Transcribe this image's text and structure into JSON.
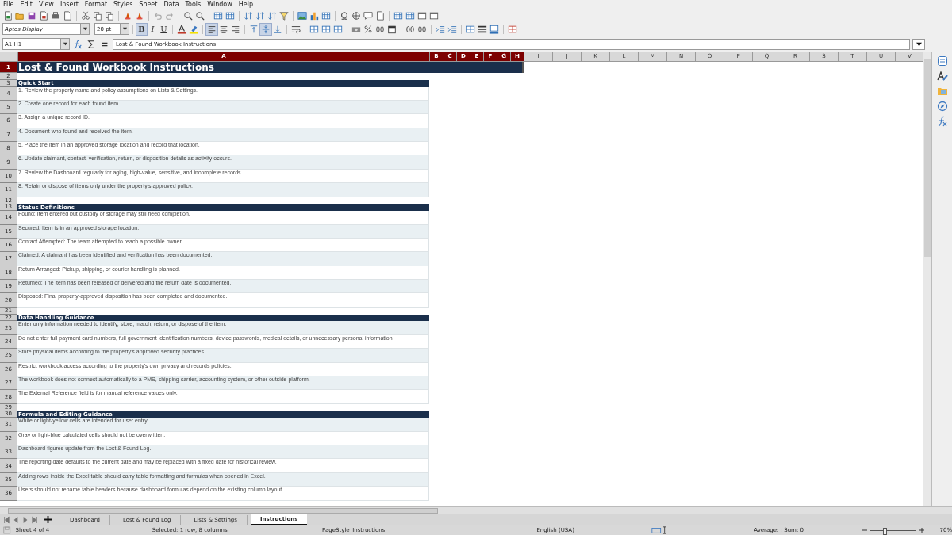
{
  "menu": [
    "File",
    "Edit",
    "View",
    "Insert",
    "Format",
    "Styles",
    "Sheet",
    "Data",
    "Tools",
    "Window",
    "Help"
  ],
  "toolbar": {
    "font_name": "Aptos Display",
    "font_size": "20 pt",
    "toggles": [
      {
        "kind": "bold",
        "label": "B",
        "on": true
      },
      {
        "kind": "italic",
        "label": "I",
        "on": false
      },
      {
        "kind": "underline",
        "label": "U",
        "on": false
      }
    ],
    "alignment": [
      {
        "kind": "left",
        "on": true
      },
      {
        "kind": "center",
        "on": false
      },
      {
        "kind": "right",
        "on": false
      },
      {
        "kind": "top",
        "on": false
      },
      {
        "kind": "middle",
        "on": true
      },
      {
        "kind": "bottom",
        "on": false
      }
    ]
  },
  "formula_bar": {
    "name_box": "A1:H1",
    "content": "Lost & Found Workbook Instructions"
  },
  "columns": [
    {
      "label": "A",
      "selected": true
    },
    {
      "label": "B",
      "selected": true
    },
    {
      "label": "C",
      "selected": true
    },
    {
      "label": "D",
      "selected": true
    },
    {
      "label": "E",
      "selected": true
    },
    {
      "label": "F",
      "selected": true
    },
    {
      "label": "G",
      "selected": true
    },
    {
      "label": "H",
      "selected": true
    },
    {
      "label": "I",
      "selected": false
    },
    {
      "label": "J",
      "selected": false
    },
    {
      "label": "K",
      "selected": false
    },
    {
      "label": "L",
      "selected": false
    },
    {
      "label": "M",
      "selected": false
    },
    {
      "label": "N",
      "selected": false
    },
    {
      "label": "O",
      "selected": false
    },
    {
      "label": "P",
      "selected": false
    },
    {
      "label": "Q",
      "selected": false
    },
    {
      "label": "R",
      "selected": false
    },
    {
      "label": "S",
      "selected": false
    },
    {
      "label": "T",
      "selected": false
    },
    {
      "label": "U",
      "selected": false
    },
    {
      "label": "V",
      "selected": false
    }
  ],
  "rows": [
    {
      "number": "1",
      "kind": "title",
      "text": "Lost & Found Workbook Instructions",
      "selected": true
    },
    {
      "number": "2",
      "kind": "blank",
      "selected": false
    },
    {
      "number": "3",
      "kind": "section",
      "text": "Quick Start",
      "selected": false
    },
    {
      "number": "4",
      "kind": "text",
      "text": "1. Review the property name and policy assumptions on Lists & Settings.",
      "selected": false,
      "shaded": false
    },
    {
      "number": "5",
      "kind": "text",
      "text": "2. Create one record for each found item.",
      "selected": false,
      "shaded": true
    },
    {
      "number": "6",
      "kind": "text",
      "text": "3. Assign a unique record ID.",
      "selected": false,
      "shaded": false
    },
    {
      "number": "7",
      "kind": "text",
      "text": "4. Document who found and received the item.",
      "selected": false,
      "shaded": true
    },
    {
      "number": "8",
      "kind": "text",
      "text": "5. Place the item in an approved storage location and record that location.",
      "selected": false,
      "shaded": false
    },
    {
      "number": "9",
      "kind": "text",
      "text": "6. Update claimant, contact, verification, return, or disposition details as activity occurs.",
      "selected": false,
      "shaded": true
    },
    {
      "number": "10",
      "kind": "text",
      "text": "7. Review the Dashboard regularly for aging, high-value, sensitive, and incomplete records.",
      "selected": false,
      "shaded": false
    },
    {
      "number": "11",
      "kind": "text",
      "text": "8. Retain or dispose of items only under the property's approved policy.",
      "selected": false,
      "shaded": true
    },
    {
      "number": "12",
      "kind": "blank",
      "selected": false
    },
    {
      "number": "13",
      "kind": "section",
      "text": "Status Definitions",
      "selected": false
    },
    {
      "number": "14",
      "kind": "text",
      "text": "Found: Item entered but custody or storage may still need completion.",
      "selected": false,
      "shaded": false
    },
    {
      "number": "15",
      "kind": "text",
      "text": "Secured: Item is in an approved storage location.",
      "selected": false,
      "shaded": true
    },
    {
      "number": "16",
      "kind": "text",
      "text": "Contact Attempted: The team attempted to reach a possible owner.",
      "selected": false,
      "shaded": false
    },
    {
      "number": "17",
      "kind": "text",
      "text": "Claimed: A claimant has been identified and verification has been documented.",
      "selected": false,
      "shaded": true
    },
    {
      "number": "18",
      "kind": "text",
      "text": "Return Arranged: Pickup, shipping, or courier handling is planned.",
      "selected": false,
      "shaded": false
    },
    {
      "number": "19",
      "kind": "text",
      "text": "Returned: The item has been released or delivered and the return date is documented.",
      "selected": false,
      "shaded": true
    },
    {
      "number": "20",
      "kind": "text",
      "text": "Disposed: Final property-approved disposition has been completed and documented.",
      "selected": false,
      "shaded": false
    },
    {
      "number": "21",
      "kind": "blank",
      "selected": false
    },
    {
      "number": "22",
      "kind": "section",
      "text": "Data Handling Guidance",
      "selected": false
    },
    {
      "number": "23",
      "kind": "text",
      "text": "Enter only information needed to identify, store, match, return, or dispose of the item.",
      "selected": false,
      "shaded": true
    },
    {
      "number": "24",
      "kind": "text",
      "text": "Do not enter full payment card numbers, full government identification numbers, device passwords, medical details, or unnecessary personal information.",
      "selected": false,
      "shaded": false
    },
    {
      "number": "25",
      "kind": "text",
      "text": "Store physical items according to the property's approved security practices.",
      "selected": false,
      "shaded": true
    },
    {
      "number": "26",
      "kind": "text",
      "text": "Restrict workbook access according to the property's own privacy and records policies.",
      "selected": false,
      "shaded": false
    },
    {
      "number": "27",
      "kind": "text",
      "text": "The workbook does not connect automatically to a PMS, shipping carrier, accounting system, or other outside platform.",
      "selected": false,
      "shaded": true
    },
    {
      "number": "28",
      "kind": "text",
      "text": "The External Reference field is for manual reference values only.",
      "selected": false,
      "shaded": false
    },
    {
      "number": "29",
      "kind": "blank",
      "selected": false
    },
    {
      "number": "30",
      "kind": "section",
      "text": "Formula and Editing Guidance",
      "selected": false
    },
    {
      "number": "31",
      "kind": "text",
      "text": "White or light-yellow cells are intended for user entry.",
      "selected": false,
      "shaded": true
    },
    {
      "number": "32",
      "kind": "text",
      "text": "Gray or light-blue calculated cells should not be overwritten.",
      "selected": false,
      "shaded": false
    },
    {
      "number": "33",
      "kind": "text",
      "text": "Dashboard figures update from the Lost & Found Log.",
      "selected": false,
      "shaded": true
    },
    {
      "number": "34",
      "kind": "text",
      "text": "The reporting date defaults to the current date and may be replaced with a fixed date for historical review.",
      "selected": false,
      "shaded": false
    },
    {
      "number": "35",
      "kind": "text",
      "text": "Adding rows inside the Excel table should carry table formatting and formulas when opened in Excel.",
      "selected": false,
      "shaded": true
    },
    {
      "number": "36",
      "kind": "text",
      "text": "Users should not rename table headers because dashboard formulas depend on the existing column layout.",
      "selected": false,
      "shaded": false
    }
  ],
  "sheet_tabs": [
    {
      "label": "Dashboard",
      "selected": false
    },
    {
      "label": "Lost & Found Log",
      "selected": false
    },
    {
      "label": "Lists & Settings",
      "selected": false
    },
    {
      "label": "Instructions",
      "selected": true
    }
  ],
  "status_bar": {
    "sheet": "Sheet 4 of 4",
    "selection": "Selected: 1 row, 8 columns",
    "page_style": "PageStyle_Instructions",
    "language": "English (USA)",
    "summary": "Average: ; Sum: 0",
    "zoom_slider": {
      "level": 0.31
    },
    "zoom": "70%"
  }
}
